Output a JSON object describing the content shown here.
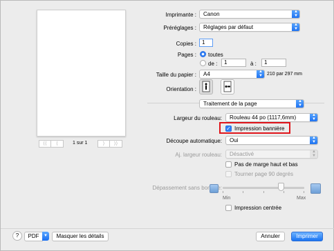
{
  "window": {
    "title": ""
  },
  "preview": {
    "pager": {
      "first": "⟨⟨",
      "prev": "⟨",
      "next": "⟩",
      "last": "⟩⟩"
    },
    "page_count": "1 sur 1"
  },
  "printer": {
    "label": "Imprimante :",
    "value": "Canon"
  },
  "presets": {
    "label": "Préréglages :",
    "value": "Réglages par défaut"
  },
  "copies": {
    "label": "Copies :",
    "value": "1"
  },
  "pages": {
    "label": "Pages :",
    "all_label": "toutes",
    "from_label": "de :",
    "from_value": "1",
    "to_label": "à :",
    "to_value": "1",
    "selected": "all"
  },
  "paper_size": {
    "label": "Taille du papier :",
    "value": "A4",
    "dimensions": "210 par 297 mm"
  },
  "orientation": {
    "label": "Orientation :",
    "selected": "portrait"
  },
  "section": {
    "value": "Traitement de la page"
  },
  "roll_width": {
    "label": "Largeur du rouleau:",
    "value": "Rouleau 44 po (1117,6mm)"
  },
  "banner": {
    "label": "Impression bannière",
    "checked": true
  },
  "auto_cut": {
    "label": "Découpe automatique:",
    "value": "Oui"
  },
  "fit_roll": {
    "label": "Aj. largeur rouleau:",
    "value": "Désactivé"
  },
  "no_margin": {
    "label": "Pas de marge haut et bas",
    "checked": false
  },
  "rotate90": {
    "label": "Tourner page 90 degrés",
    "checked": false
  },
  "borderless": {
    "label": "Dépassement sans bordure:",
    "min_label": "Min",
    "max_label": "Max",
    "level": 0.72
  },
  "centered": {
    "label": "Impression centrée",
    "checked": false
  },
  "footer": {
    "help": "?",
    "pdf": "PDF",
    "hide_details": "Masquer les détails",
    "cancel": "Annuler",
    "print": "Imprimer"
  }
}
